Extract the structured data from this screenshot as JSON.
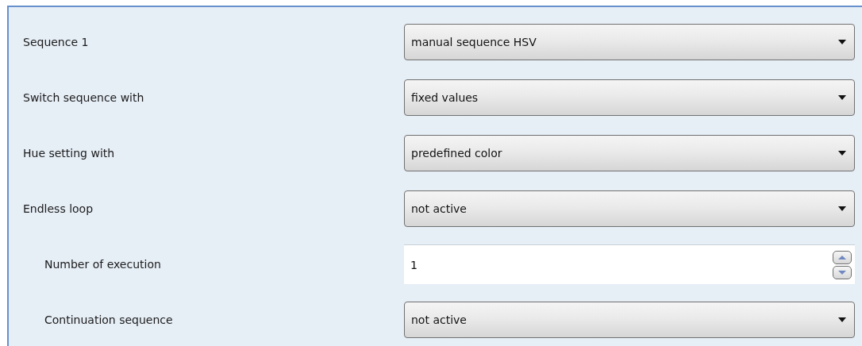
{
  "parameters": [
    {
      "label": "Sequence 1",
      "kind": "dropdown",
      "value": "manual sequence HSV"
    },
    {
      "label": "Switch sequence with",
      "kind": "dropdown",
      "value": "fixed values"
    },
    {
      "label": "Hue setting with",
      "kind": "dropdown",
      "value": "predefined color"
    },
    {
      "label": "Endless loop",
      "kind": "dropdown",
      "value": "not active",
      "children": [
        {
          "label": "Number of execution",
          "kind": "spin",
          "value": "1"
        },
        {
          "label": "Continuation sequence",
          "kind": "dropdown",
          "value": "not active"
        }
      ]
    }
  ]
}
